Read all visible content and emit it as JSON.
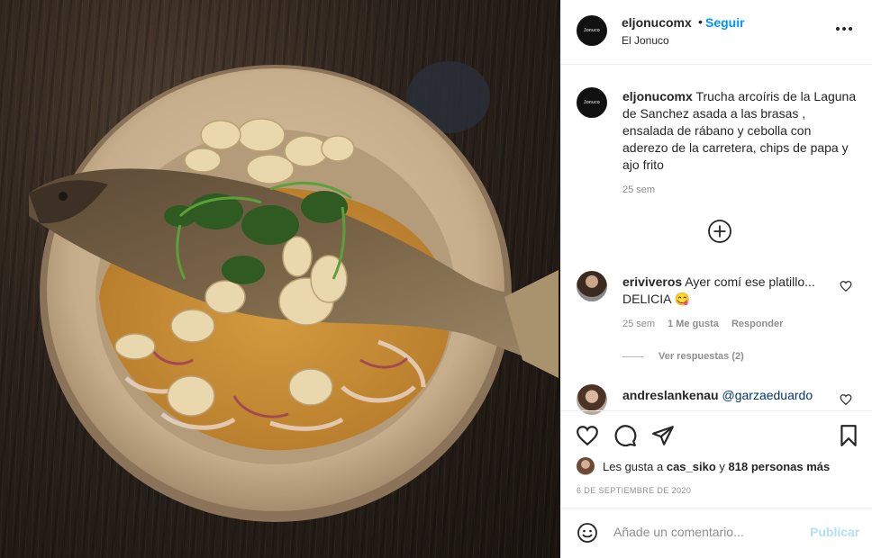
{
  "post": {
    "username": "eljonucomx",
    "follow_label": "Seguir",
    "location": "El Jonuco",
    "avatar_text": "Jonuco",
    "more_icon": "more-horizontal-icon",
    "photo_subject": "food-photo"
  },
  "caption": {
    "username": "eljonucomx",
    "text": "Trucha arcoíris de la Laguna de Sanchez asada a las brasas , ensalada de rábano y cebolla con aderezo de la carretera, chips de papa y ajo frito",
    "time": "25 sem"
  },
  "load_more_icon": "plus-circle-icon",
  "comments": [
    {
      "username": "eriviveros",
      "text": "Ayer comí ese platillo... DELICIA 😋",
      "time": "25 sem",
      "likes": "1 Me gusta",
      "reply_label": "Responder",
      "view_replies": "Ver respuestas (2)"
    },
    {
      "username": "andreslankenau",
      "mention": "@garzaeduardo"
    }
  ],
  "actions": {
    "like_icon": "heart-icon",
    "comment_icon": "comment-icon",
    "share_icon": "paper-plane-icon",
    "save_icon": "bookmark-icon"
  },
  "likes": {
    "prefix": "Les gusta a",
    "user": "cas_siko",
    "connector": "y",
    "others": "818 personas más"
  },
  "date": "6 DE SEPTIEMBRE DE 2020",
  "comment_box": {
    "placeholder": "Añade un comentario...",
    "publish_label": "Publicar"
  },
  "colors": {
    "link_blue": "#0095f6",
    "publish_disabled": "#b2dffc",
    "secondary_text": "#8e8e8e"
  }
}
